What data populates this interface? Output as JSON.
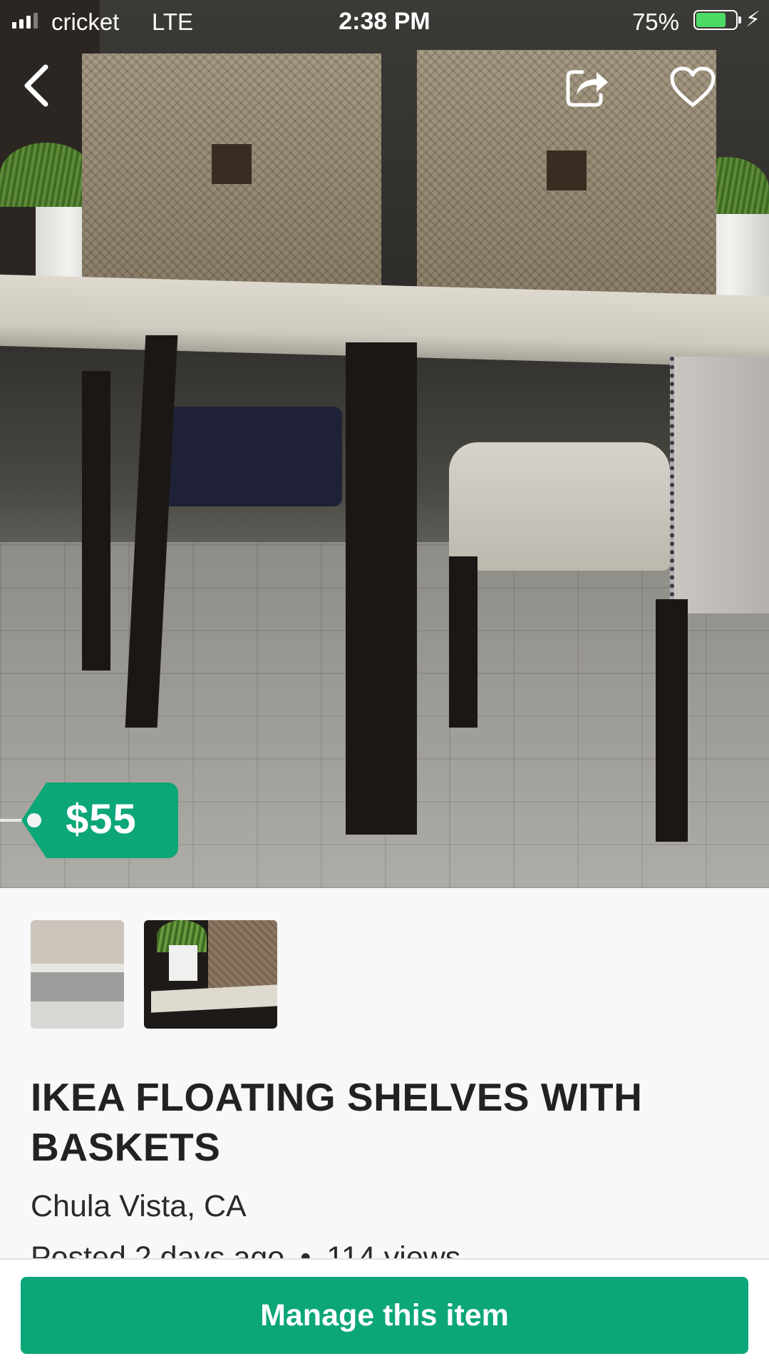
{
  "status_bar": {
    "carrier": "cricket",
    "network": "LTE",
    "time": "2:38 PM",
    "battery_percent_label": "75%",
    "battery_level": 0.75,
    "battery_color": "#4cd964"
  },
  "nav": {
    "back_icon": "chevron-left-icon",
    "share_icon": "share-icon",
    "favorite_icon": "heart-icon"
  },
  "listing": {
    "price": "$55",
    "title": "IKEA FLOATING SHELVES WITH BASKETS",
    "location": "Chula Vista, CA",
    "posted": "Posted 2 days ago",
    "separator": "•",
    "views": "114 views",
    "photo_count": 2
  },
  "actions": {
    "manage_label": "Manage this item"
  },
  "colors": {
    "accent": "#0ca678",
    "background": "#f8f8f8",
    "text": "#222222"
  }
}
